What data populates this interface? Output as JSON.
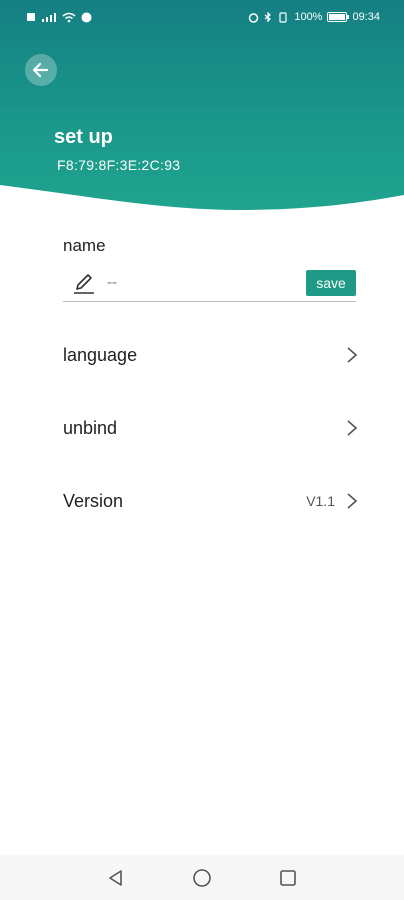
{
  "status_bar": {
    "left_icons": [
      "sim-icon",
      "signal-icon",
      "wifi-icon",
      "vpn-icon"
    ],
    "right_icons": [
      "alarm-icon",
      "bluetooth-icon",
      "vibrate-icon"
    ],
    "battery_text": "100%",
    "time": "09:34"
  },
  "header": {
    "title": "set up",
    "mac": "F8:79:8F:3E:2C:93",
    "colors": {
      "gradient_top": "#157f83",
      "gradient_bottom": "#20a48f"
    }
  },
  "name_section": {
    "label": "name",
    "value": "--",
    "save_label": "save"
  },
  "menu": [
    {
      "label": "language",
      "value": ""
    },
    {
      "label": "unbind",
      "value": ""
    },
    {
      "label": "Version",
      "value": "V1.1"
    }
  ],
  "nav": [
    "back-icon",
    "home-icon",
    "recents-icon"
  ],
  "accent": "#1f9a86"
}
